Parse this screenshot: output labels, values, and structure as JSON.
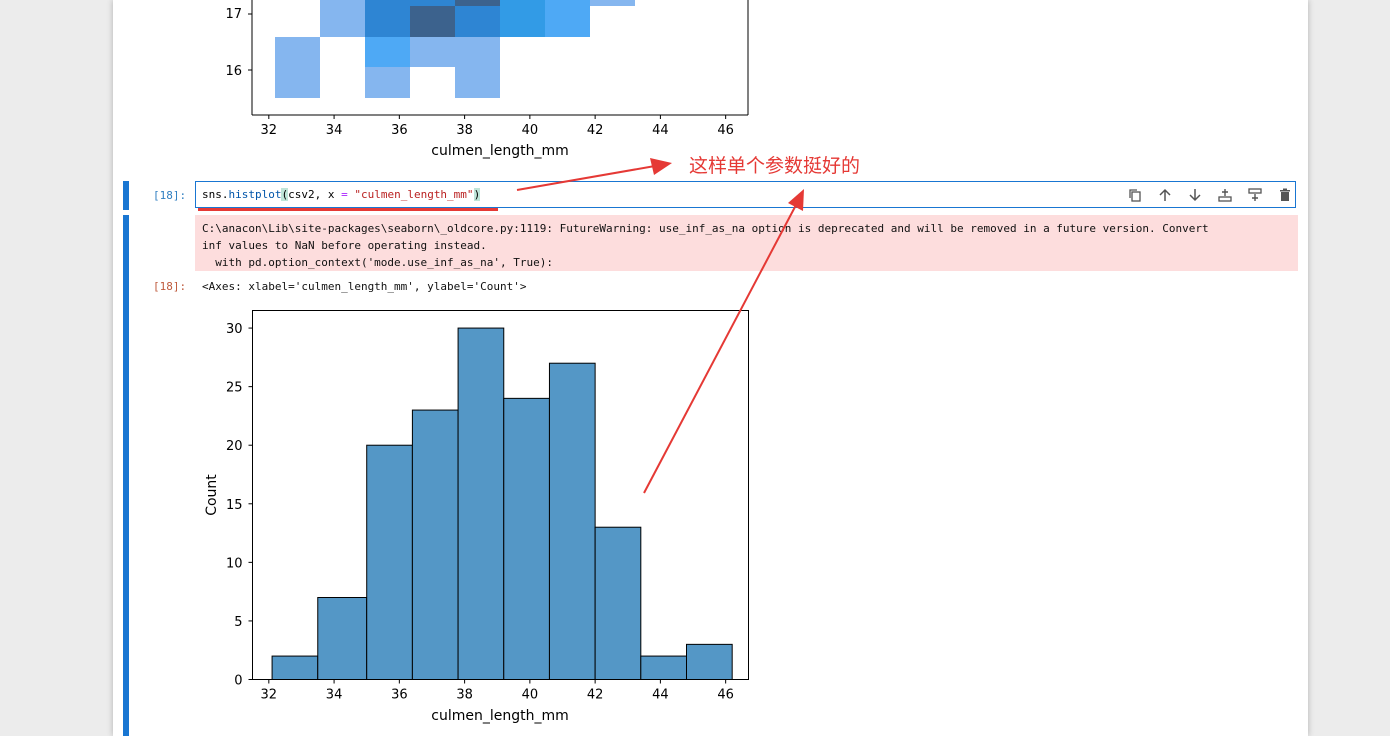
{
  "notebook": {
    "prompt_in": "[18]:",
    "prompt_out": "[18]:",
    "code": {
      "var": "sns",
      "dot": ".",
      "func": "histplot",
      "open": "(",
      "args_a": "csv2, x ",
      "op": "=",
      "space": " ",
      "str": "\"culmen_length_mm\"",
      "close": ")"
    },
    "toolbar": {
      "duplicate_icon": "copy-icon",
      "move_up_icon": "arrow-up-icon",
      "move_down_icon": "arrow-down-icon",
      "insert_above_icon": "insert-above-icon",
      "insert_below_icon": "insert-below-icon",
      "delete_icon": "trash-icon"
    },
    "stderr_lines": [
      "C:\\anacon\\Lib\\site-packages\\seaborn\\_oldcore.py:1119: FutureWarning: use_inf_as_na option is deprecated and will be removed in a future version. Convert",
      "inf values to NaN before operating instead.",
      "  with pd.option_context('mode.use_inf_as_na', True):"
    ],
    "output_text": "<Axes: xlabel='culmen_length_mm', ylabel='Count'>",
    "annotation": "这样单个参数挺好的",
    "colors": {
      "accent": "#1976d2",
      "stderr_bg": "#fddddd",
      "annotation": "#e53935",
      "bar": "#5497c6"
    }
  },
  "top_chart": {
    "xlabel": "culmen_length_mm",
    "ytick_labels": [
      "17",
      "16"
    ],
    "xtick_labels": [
      "32",
      "34",
      "36",
      "38",
      "40",
      "42",
      "44",
      "46"
    ]
  },
  "chart_data": {
    "type": "bar",
    "categories": [
      "32.1-33.5",
      "33.5-35.0",
      "35.0-36.4",
      "36.4-37.8",
      "37.8-39.2",
      "39.2-40.6",
      "40.6-42.0",
      "42.0-43.4",
      "43.4-44.8",
      "44.8-46.2"
    ],
    "bin_edges": [
      32.1,
      33.5,
      35.0,
      36.4,
      37.8,
      39.2,
      40.6,
      42.0,
      43.4,
      44.8,
      46.2
    ],
    "values": [
      2,
      7,
      20,
      23,
      30,
      24,
      27,
      13,
      2,
      3
    ],
    "xlabel": "culmen_length_mm",
    "ylabel": "Count",
    "xlim": [
      31.5,
      46.7
    ],
    "ylim": [
      0,
      31.5
    ],
    "xticks": [
      "32",
      "34",
      "36",
      "38",
      "40",
      "42",
      "44",
      "46"
    ],
    "yticks": [
      "0",
      "5",
      "10",
      "15",
      "20",
      "25",
      "30"
    ],
    "grid": false
  }
}
